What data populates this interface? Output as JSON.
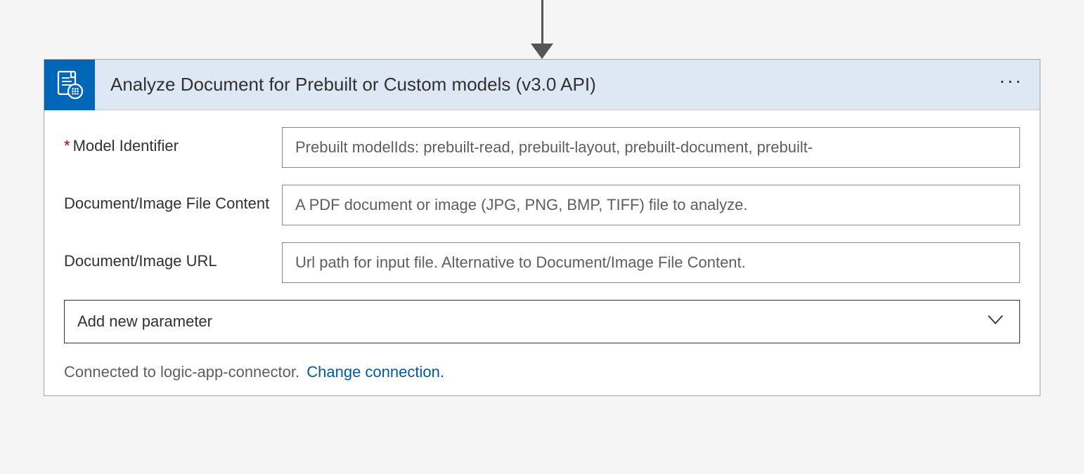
{
  "header": {
    "title": "Analyze Document for Prebuilt or Custom models (v3.0 API)"
  },
  "fields": {
    "modelIdentifier": {
      "label": "Model Identifier",
      "required": true,
      "placeholder": "Prebuilt modelIds: prebuilt-read, prebuilt-layout, prebuilt-document, prebuilt-"
    },
    "fileContent": {
      "label": "Document/Image File Content",
      "required": false,
      "placeholder": "A PDF document or image (JPG, PNG, BMP, TIFF) file to analyze."
    },
    "imageUrl": {
      "label": "Document/Image URL",
      "required": false,
      "placeholder": "Url path for input file. Alternative to Document/Image File Content."
    }
  },
  "dropdown": {
    "label": "Add new parameter"
  },
  "footer": {
    "connectedText": "Connected to logic-app-connector.",
    "changeLink": "Change connection."
  }
}
